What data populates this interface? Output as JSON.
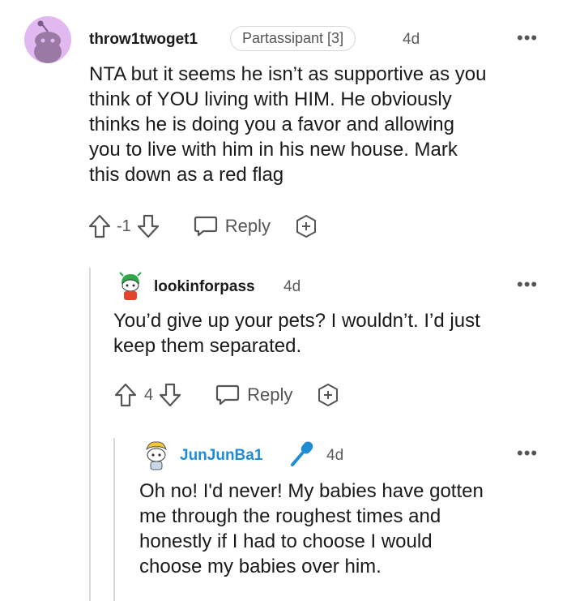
{
  "comments": [
    {
      "username": "throw1twoget1",
      "flair": "Partassipant [3]",
      "age": "4d",
      "text": "NTA but it seems he isn’t as supportive as you think of YOU living with HIM. He obviously thinks he is doing you a favor and allowing you to live with him in his new house. Mark this down as a red flag",
      "lines": [
        "NTA but it seems he isn’t as supportive as you",
        "think of YOU living with HIM. He obviously",
        "thinks he is doing you a favor and allowing",
        "you to live with him in his new house. Mark",
        "this down as a red flag"
      ],
      "votes": "-1",
      "reply_label": "Reply",
      "more_label": "•••"
    },
    {
      "username": "lookinforpass",
      "age": "4d",
      "lines": [
        "You’d give up your pets? I wouldn’t. I’d just",
        "keep them separated."
      ],
      "votes": "4",
      "reply_label": "Reply",
      "more_label": "•••"
    },
    {
      "username": "JunJunBa1",
      "age": "4d",
      "lines": [
        "Oh no! I'd never! My babies have gotten",
        "me through the roughest times and",
        "honestly if I had to choose I would",
        "choose my babies over him."
      ],
      "more_label": "•••"
    }
  ],
  "colors": {
    "avatar1_bg": "#e1b8f0",
    "op_username": "#1f8dd6",
    "mic_icon": "#1f8dd6",
    "thread_line": "#d9d9d9"
  },
  "icons": [
    "upvote-icon",
    "downvote-icon",
    "reply-icon",
    "award-icon",
    "more-icon",
    "microphone-icon"
  ]
}
